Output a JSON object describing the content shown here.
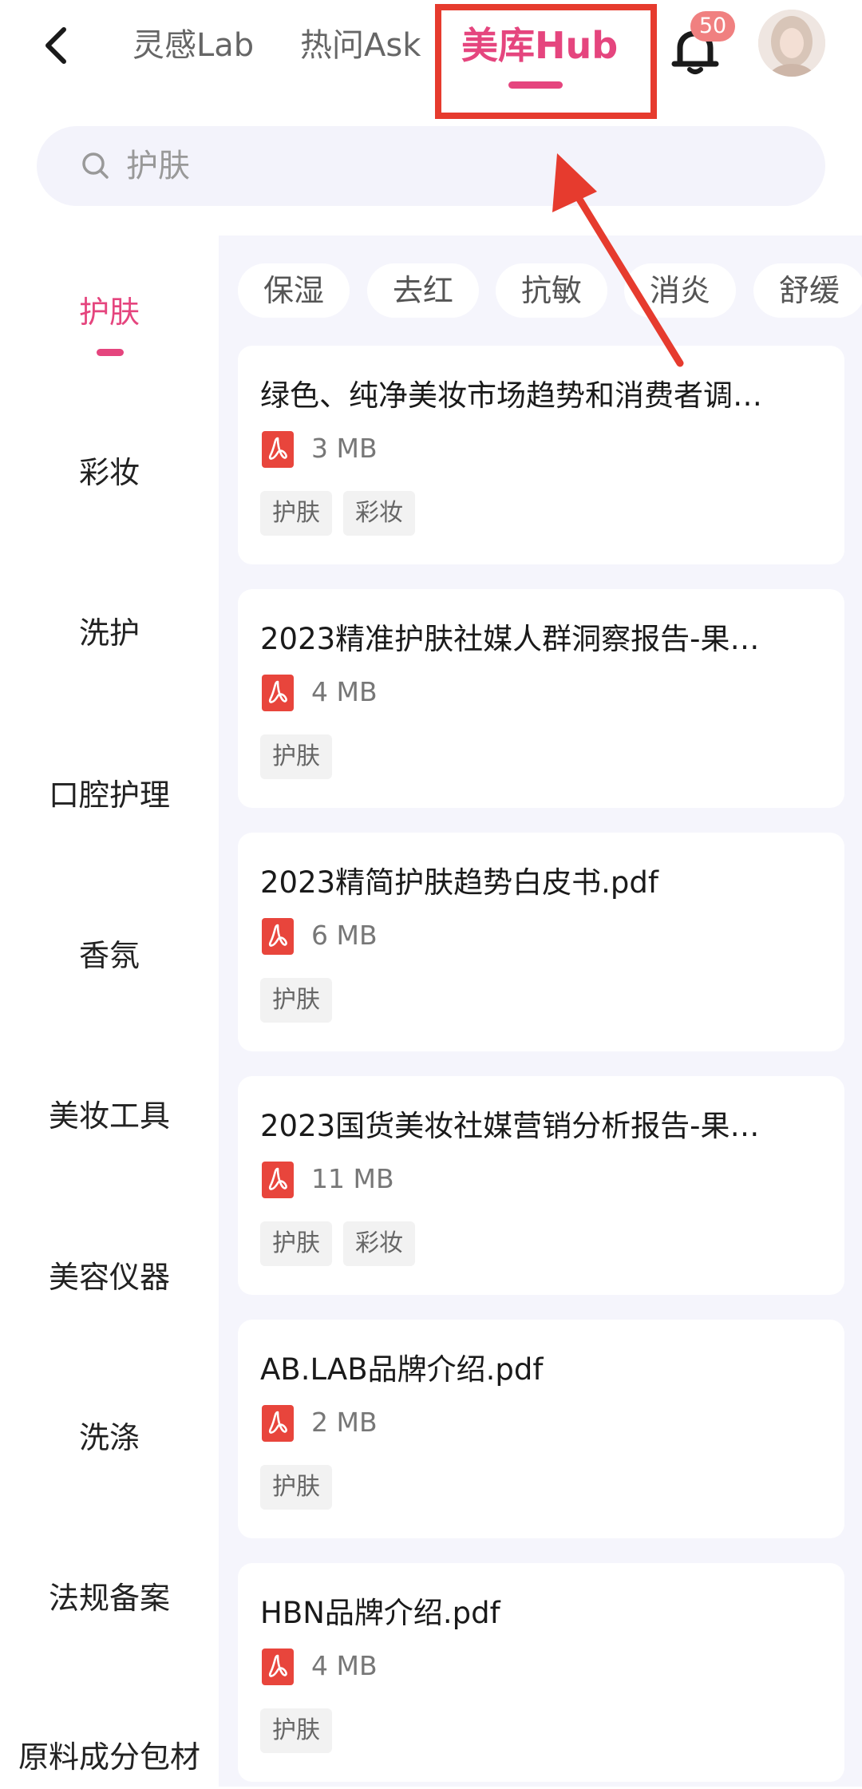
{
  "header": {
    "tabs": [
      {
        "label": "灵感Lab"
      },
      {
        "label": "热问Ask"
      },
      {
        "label": "美库Hub",
        "active": true
      }
    ],
    "notification_count": "50"
  },
  "search": {
    "placeholder": "护肤"
  },
  "sidebar": {
    "items": [
      {
        "label": "护肤",
        "active": true
      },
      {
        "label": "彩妆"
      },
      {
        "label": "洗护"
      },
      {
        "label": "口腔护理"
      },
      {
        "label": "香氛"
      },
      {
        "label": "美妆工具"
      },
      {
        "label": "美容仪器"
      },
      {
        "label": "洗涤"
      },
      {
        "label": "法规备案"
      },
      {
        "label": "原料成分包材"
      }
    ]
  },
  "filters": {
    "chips": [
      "保湿",
      "去红",
      "抗敏",
      "消炎",
      "舒缓"
    ]
  },
  "documents": [
    {
      "title": "绿色、纯净美妆市场趋势和消费者调…",
      "size": "3 MB",
      "tags": [
        "护肤",
        "彩妆"
      ]
    },
    {
      "title": "2023精准护肤社媒人群洞察报告-果…",
      "size": "4 MB",
      "tags": [
        "护肤"
      ]
    },
    {
      "title": "2023精简护肤趋势白皮书.pdf",
      "size": "6 MB",
      "tags": [
        "护肤"
      ]
    },
    {
      "title": "2023国货美妆社媒营销分析报告-果…",
      "size": "11 MB",
      "tags": [
        "护肤",
        "彩妆"
      ]
    },
    {
      "title": "AB.LAB品牌介绍.pdf",
      "size": "2 MB",
      "tags": [
        "护肤"
      ]
    },
    {
      "title": "HBN品牌介绍.pdf",
      "size": "4 MB",
      "tags": [
        "护肤"
      ]
    }
  ],
  "colors": {
    "accent": "#e5457e",
    "annotation": "#e63b2e",
    "panel_background": "#f5f5fc",
    "pdf_icon": "#e8453c"
  },
  "icons": {
    "back": "chevron-left-icon",
    "notification": "bell-icon",
    "search": "search-icon",
    "file": "pdf-icon"
  }
}
